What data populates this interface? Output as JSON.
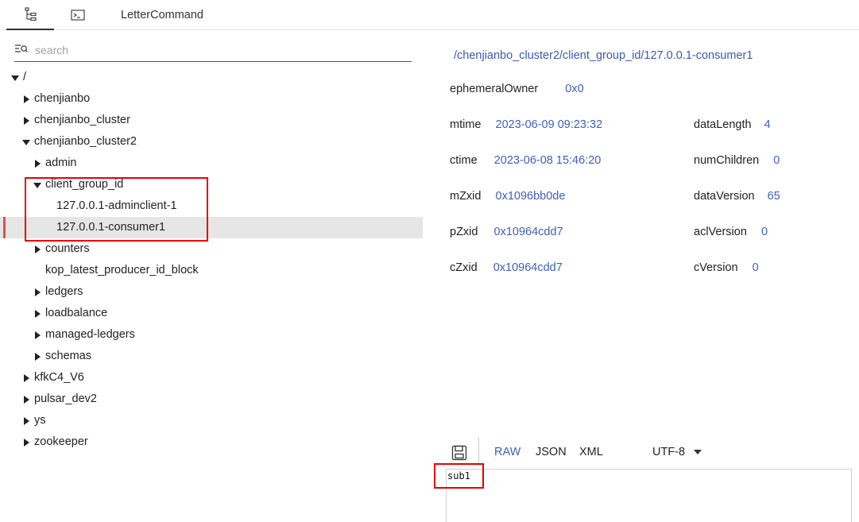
{
  "tabs": {
    "tree_icon": "tree-icon",
    "terminal_icon": "terminal-icon",
    "letter_label": "LetterCommand"
  },
  "search": {
    "placeholder": "search",
    "value": ""
  },
  "tree": {
    "rows": [
      {
        "label": "/",
        "arrow": "down"
      },
      {
        "label": "chenjianbo",
        "arrow": "right"
      },
      {
        "label": "chenjianbo_cluster",
        "arrow": "right"
      },
      {
        "label": "chenjianbo_cluster2",
        "arrow": "down"
      },
      {
        "label": "admin",
        "arrow": "right"
      },
      {
        "label": "client_group_id",
        "arrow": "down"
      },
      {
        "label": "127.0.0.1-adminclient-1",
        "arrow": "none"
      },
      {
        "label": "127.0.0.1-consumer1",
        "arrow": "none",
        "selected": true
      },
      {
        "label": "counters",
        "arrow": "right"
      },
      {
        "label": "kop_latest_producer_id_block",
        "arrow": "none"
      },
      {
        "label": "ledgers",
        "arrow": "right"
      },
      {
        "label": "loadbalance",
        "arrow": "right"
      },
      {
        "label": "managed-ledgers",
        "arrow": "right"
      },
      {
        "label": "schemas",
        "arrow": "right"
      },
      {
        "label": "kfkC4_V6",
        "arrow": "right"
      },
      {
        "label": "pulsar_dev2",
        "arrow": "right"
      },
      {
        "label": "ys",
        "arrow": "right"
      },
      {
        "label": "zookeeper",
        "arrow": "right"
      }
    ]
  },
  "details": {
    "path": "/chenjianbo_cluster2/client_group_id/127.0.0.1-consumer1",
    "ephemeralOwner": {
      "key": "ephemeralOwner",
      "value": "0x0"
    },
    "mtime": {
      "key": "mtime",
      "value": "2023-06-09 09:23:32"
    },
    "ctime": {
      "key": "ctime",
      "value": "2023-06-08 15:46:20"
    },
    "mZxid": {
      "key": "mZxid",
      "value": "0x1096bb0de"
    },
    "pZxid": {
      "key": "pZxid",
      "value": "0x10964cdd7"
    },
    "cZxid": {
      "key": "cZxid",
      "value": "0x10964cdd7"
    },
    "dataLength": {
      "key": "dataLength",
      "value": "4"
    },
    "numChildren": {
      "key": "numChildren",
      "value": "0"
    },
    "dataVersion": {
      "key": "dataVersion",
      "value": "65"
    },
    "aclVersion": {
      "key": "aclVersion",
      "value": "0"
    },
    "cVersion": {
      "key": "cVersion",
      "value": "0"
    }
  },
  "toolbar": {
    "save_icon": "save-icon",
    "formats": [
      "RAW",
      "JSON",
      "XML"
    ],
    "active_format": "RAW",
    "encoding": "UTF-8"
  },
  "editor": {
    "content": "sub1"
  },
  "colors": {
    "accent": "#3f5fae",
    "highlight_box": "#e60000",
    "selected_row": "#e6e6e6"
  }
}
